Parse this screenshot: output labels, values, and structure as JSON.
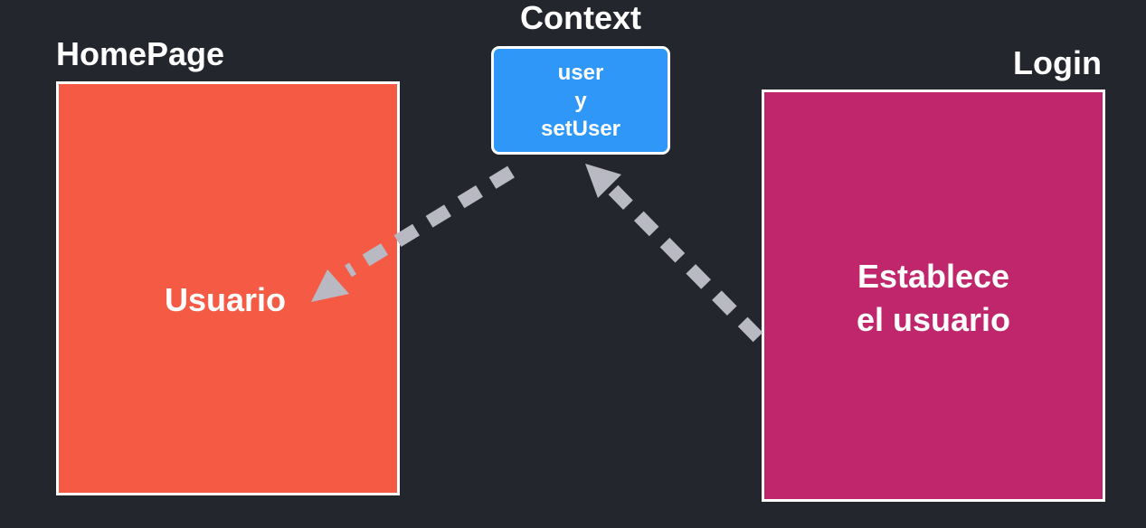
{
  "colors": {
    "background": "#24262d",
    "homepage_fill": "#f55a45",
    "login_fill": "#c0266c",
    "context_fill": "#2e97f8",
    "border": "#ffffff",
    "arrow": "#b8b9c2"
  },
  "homepage": {
    "title": "HomePage",
    "content": "Usuario"
  },
  "context": {
    "title": "Context",
    "lines": [
      "user",
      "y",
      "setUser"
    ]
  },
  "login": {
    "title": "Login",
    "lines": [
      "Establece",
      "el usuario"
    ]
  },
  "arrows": [
    {
      "from": "context",
      "to": "homepage",
      "style": "dashed"
    },
    {
      "from": "login",
      "to": "context",
      "style": "dashed"
    }
  ]
}
